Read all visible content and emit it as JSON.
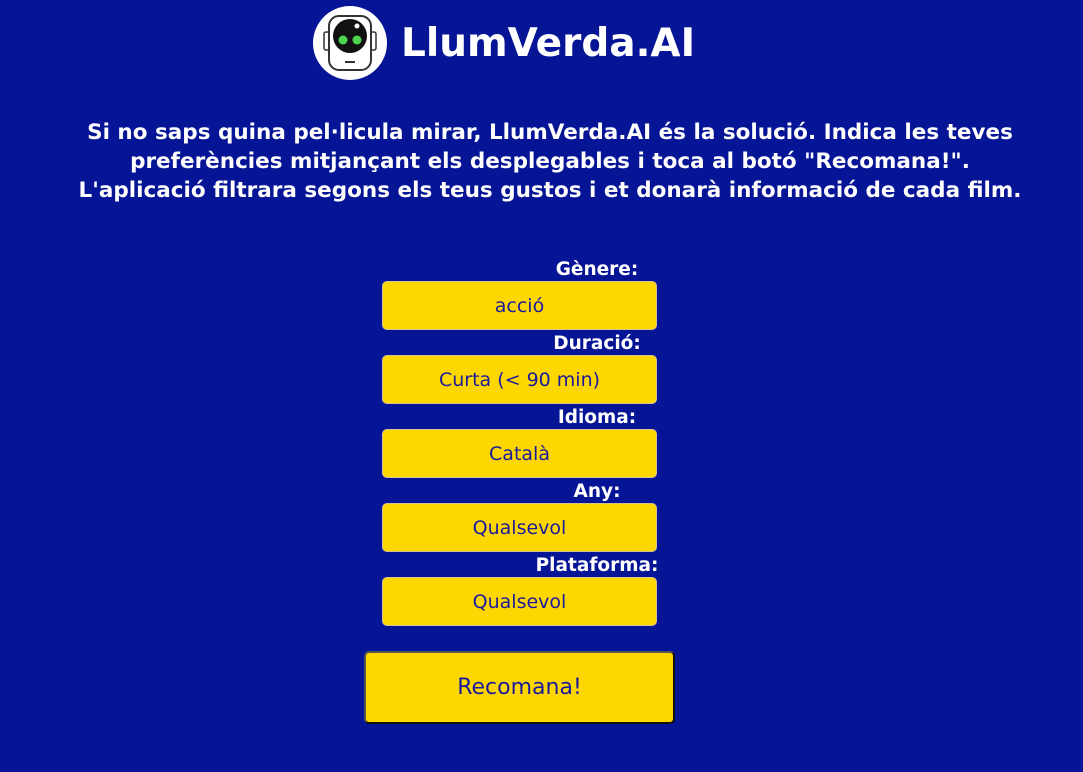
{
  "header": {
    "title": "LlumVerda.AI",
    "logo_icon": "robot-head-icon"
  },
  "intro": "Si no saps quina pel·licula mirar, LlumVerda.AI és la solució. Indica les teves preferències mitjançant els desplegables i toca al botó \"Recomana!\". L'aplicació filtrara segons els teus gustos i et donarà informació de cada film.",
  "fields": [
    {
      "label": "Gènere:",
      "value": "acció"
    },
    {
      "label": "Duració:",
      "value": "Curta (< 90 min)"
    },
    {
      "label": "Idioma:",
      "value": "Català"
    },
    {
      "label": "Any:",
      "value": "Qualsevol"
    },
    {
      "label": "Plataforma:",
      "value": "Qualsevol"
    }
  ],
  "recommend_button": "Recomana!",
  "colors": {
    "background": "#061496",
    "accent": "#FFD700",
    "select_text": "#1a1a9c"
  }
}
